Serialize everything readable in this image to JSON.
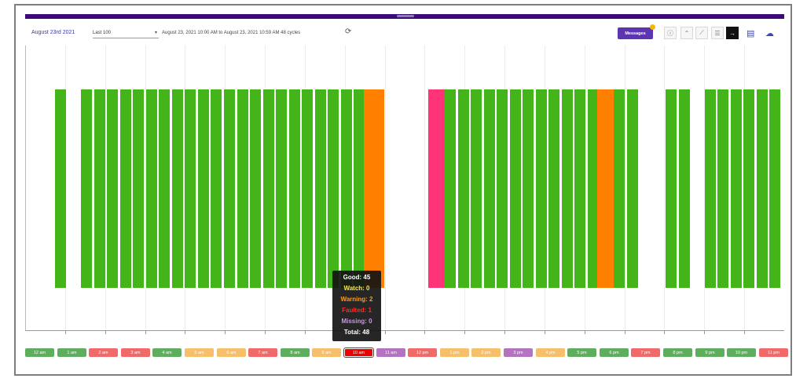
{
  "header": {
    "date": "August 23rd 2021",
    "select_value": "Last 100",
    "range_text": "August 23, 2021 10:00 AM to August 23, 2021 10:59 AM 48 cycles",
    "messages_label": "Messages"
  },
  "toolbar": {
    "icons": [
      "info-icon",
      "area-chart-icon",
      "line-chart-icon",
      "list-icon",
      "arrow-right-icon"
    ],
    "active_index": 4,
    "extra_icons": [
      "document-icon",
      "cloud-download-icon"
    ]
  },
  "colors": {
    "good": "#44b518",
    "watch": "#f5e64d",
    "warning": "#ff7f00",
    "faulted": "#ff3377",
    "missing": "#b07cc6",
    "hour_good": "#5fae5f",
    "hour_warning": "#f6c06a",
    "hour_faulted": "#f06a6a",
    "hour_missing": "#b473c0"
  },
  "chart_data": {
    "type": "bar",
    "bars": [
      "good",
      "missing",
      "good",
      "good",
      "good",
      "good",
      "good",
      "good",
      "good",
      "good",
      "good",
      "good",
      "good",
      "good",
      "good",
      "good",
      "good",
      "good",
      "good",
      "good",
      "good",
      "good",
      "good",
      "good",
      "warning",
      "missing",
      "missing",
      "missing",
      "missing",
      "faulted",
      "good",
      "good",
      "good",
      "good",
      "good",
      "good",
      "good",
      "good",
      "good",
      "good",
      "good",
      "good",
      "warning",
      "good",
      "good",
      "missing",
      "missing",
      "good",
      "good",
      "missing",
      "good",
      "good",
      "good",
      "good",
      "good",
      "good"
    ],
    "tooltip": {
      "good": "Good: 45",
      "watch": "Watch: 0",
      "warning": "Warning: 2",
      "faulted": "Faulted: 1",
      "missing": "Missing: 0",
      "total": "Total: 48"
    }
  },
  "hours": [
    {
      "label": "12 am",
      "status": "good"
    },
    {
      "label": "1 am",
      "status": "good"
    },
    {
      "label": "2 am",
      "status": "faulted"
    },
    {
      "label": "3 am",
      "status": "faulted"
    },
    {
      "label": "4 am",
      "status": "good"
    },
    {
      "label": "5 am",
      "status": "warning"
    },
    {
      "label": "6 am",
      "status": "warning"
    },
    {
      "label": "7 am",
      "status": "faulted"
    },
    {
      "label": "8 am",
      "status": "good"
    },
    {
      "label": "9 am",
      "status": "warning"
    },
    {
      "label": "10 am",
      "status": "selected"
    },
    {
      "label": "11 am",
      "status": "missing"
    },
    {
      "label": "12 pm",
      "status": "faulted"
    },
    {
      "label": "1 pm",
      "status": "warning"
    },
    {
      "label": "2 pm",
      "status": "warning"
    },
    {
      "label": "3 pm",
      "status": "missing"
    },
    {
      "label": "4 pm",
      "status": "warning"
    },
    {
      "label": "5 pm",
      "status": "good"
    },
    {
      "label": "6 pm",
      "status": "good"
    },
    {
      "label": "7 pm",
      "status": "faulted"
    },
    {
      "label": "8 pm",
      "status": "good"
    },
    {
      "label": "9 pm",
      "status": "good"
    },
    {
      "label": "10 pm",
      "status": "good"
    },
    {
      "label": "11 pm",
      "status": "faulted"
    }
  ]
}
